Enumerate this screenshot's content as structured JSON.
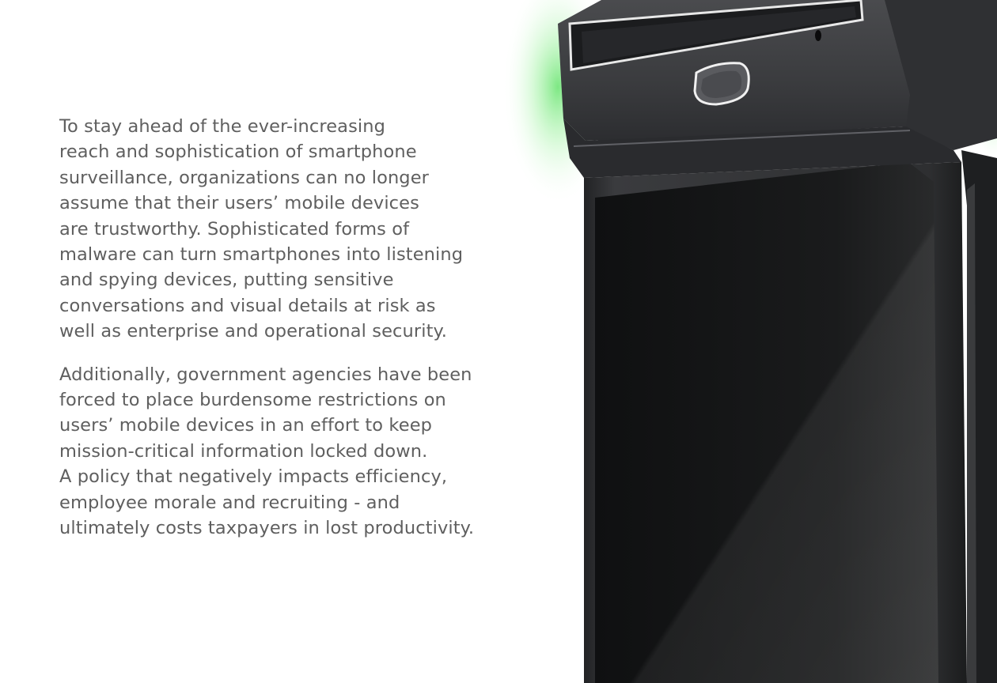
{
  "paragraphs": [
    {
      "lines": [
        "To stay ahead of the ever-increasing",
        "reach and sophistication of smartphone",
        "surveillance, organizations can no longer",
        "assume that their users’ mobile devices",
        "are trustworthy. Sophisticated forms of",
        "malware can turn smartphones into listening",
        "and spying devices, putting sensitive",
        "conversations and visual details at risk as",
        "well as enterprise and operational security."
      ]
    },
    {
      "lines": [
        "Additionally, government agencies have been",
        "forced to place burdensome restrictions on",
        "users’ mobile devices in an effort to keep",
        "mission-critical information locked down.",
        "A policy that negatively impacts efficiency,",
        "employee morale and recruiting - and",
        "ultimately costs taxpayers in lost productivity."
      ]
    }
  ],
  "colors": {
    "text": "#5f5f5f",
    "background": "#ffffff",
    "device_body": "#2a2b2d",
    "device_screen": "#141516",
    "glow": "#52e05a"
  }
}
